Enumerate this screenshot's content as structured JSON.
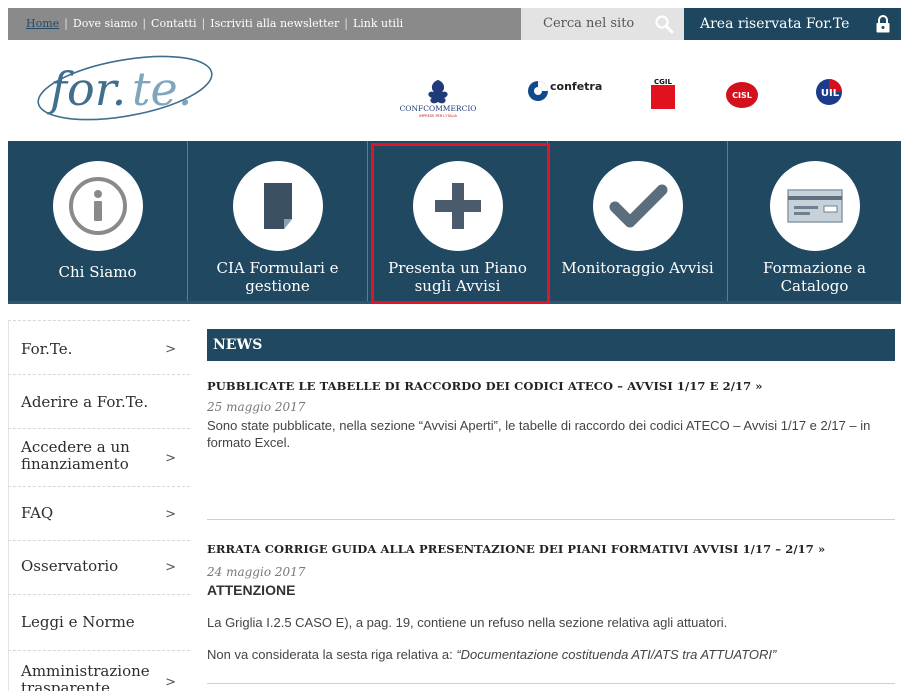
{
  "topbar": {
    "links": [
      "Home",
      "Dove siamo",
      "Contatti",
      "Iscriviti alla newsletter",
      "Link utili"
    ],
    "search_label": "Cerca nel sito",
    "reserved_label": "Area riservata For.Te"
  },
  "header": {
    "logo_text": "for.te.",
    "partners": [
      "CONFCOMMERCIO",
      "IMPRESE PER L'ITALIA",
      "confetra",
      "CGIL",
      "CISL",
      "UIL"
    ]
  },
  "nav": {
    "tiles": [
      {
        "label": "Chi Siamo",
        "icon": "info-icon"
      },
      {
        "label": "CIA Formulari e gestione",
        "icon": "document-icon"
      },
      {
        "label": "Presenta un Piano sugli Avvisi",
        "icon": "plus-icon"
      },
      {
        "label": "Monitoraggio Avvisi",
        "icon": "checkmark-icon"
      },
      {
        "label": "Formazione a Catalogo",
        "icon": "check-card-icon"
      }
    ]
  },
  "sidebar": {
    "items": [
      {
        "label": "For.Te.",
        "arrow": ">"
      },
      {
        "label": "Aderire a For.Te.",
        "arrow": ""
      },
      {
        "label": "Accedere a un finanziamento",
        "arrow": ">"
      },
      {
        "label": "FAQ",
        "arrow": ">"
      },
      {
        "label": "Osservatorio",
        "arrow": ">"
      },
      {
        "label": "Leggi e Norme",
        "arrow": ""
      },
      {
        "label": "Amministrazione trasparente",
        "arrow": ">"
      }
    ]
  },
  "news": {
    "heading": "NEWS",
    "articles": [
      {
        "title": "PUBBLICATE LE TABELLE DI RACCORDO DEI CODICI ATECO – AVVISI 1/17 E 2/17 »",
        "date": "25 maggio 2017",
        "body": "Sono state pubblicate, nella sezione “Avvisi Aperti”, le tabelle di raccordo dei codici ATECO – Avvisi 1/17 e 2/17 – in formato Excel."
      },
      {
        "title": "ERRATA CORRIGE GUIDA ALLA PRESENTAZIONE DEI PIANI FORMATIVI AVVISI 1/17 – 2/17 »",
        "date": "24 maggio 2017",
        "heading": "ATTENZIONE",
        "para1": "La Griglia I.2.5  CASO E), a pag. 19, contiene un refuso nella sezione relativa agli attuatori.",
        "para2_prefix": "Non va considerata la sesta riga relativa a: ",
        "para2_quote": "“Documentazione costituenda ATI/ATS tra ATTUATORI”"
      }
    ]
  }
}
